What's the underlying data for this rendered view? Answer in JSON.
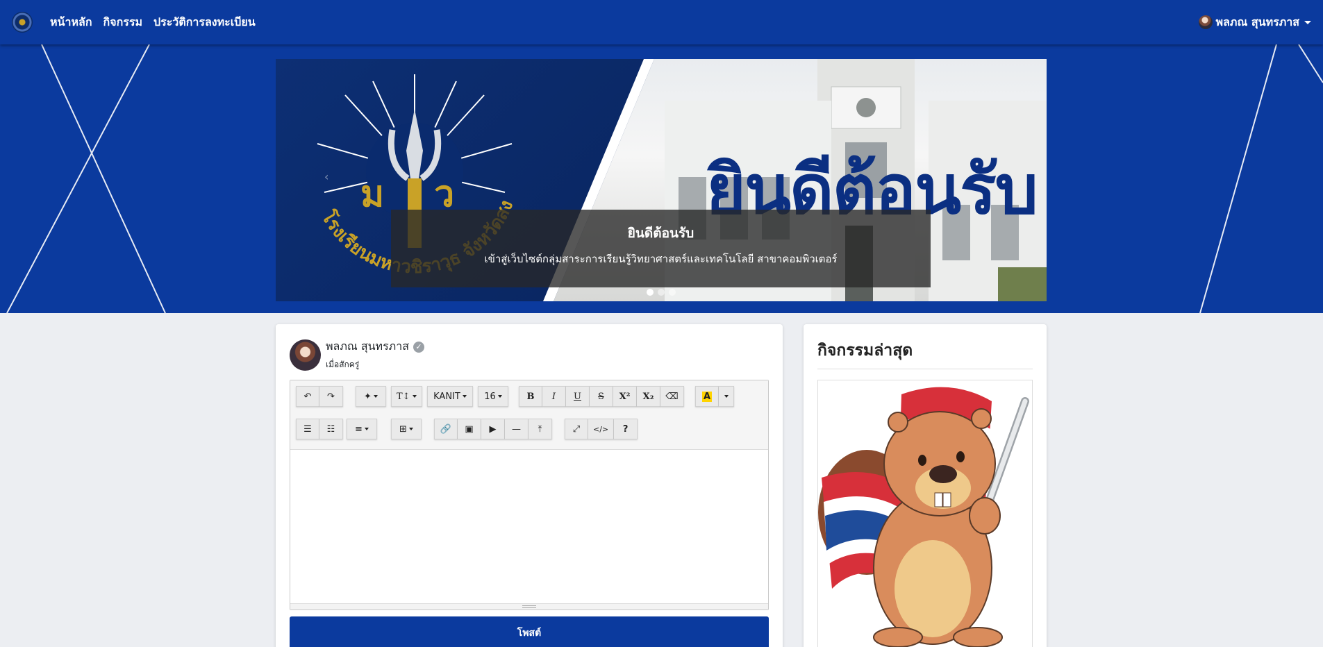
{
  "navbar": {
    "links": [
      "หน้าหลัก",
      "กิจกรรม",
      "ประวัติการลงทะเบียน"
    ],
    "user_name": "พลภณ สุนทรภาส"
  },
  "carousel": {
    "banner_text": "ยินดีต้อนรับ",
    "caption_title": "ยินดีต้อนรับ",
    "caption_text": "เข้าสู่เว็บไซต์กลุ่มสาระการเรียนรู้วิทยาศาสตร์และเทคโนโลยี สาขาคอมพิวเตอร์",
    "slide_count": 3,
    "active_slide": 1,
    "emblem_text": "โรงเรียนมหาวชิราวุธ จังหวัดสงขลา"
  },
  "post": {
    "author_name": "พลภณ สุนทรภาส",
    "author_role": "เมื่อสักครู่",
    "toolbar": {
      "font_family": "KANIT",
      "font_size": "16",
      "help": "?"
    },
    "submit_label": "โพสต์"
  },
  "sidebar": {
    "title": "กิจกรรมล่าสุด"
  },
  "colors": {
    "primary": "#0b3a9e",
    "background": "#eceef2"
  }
}
